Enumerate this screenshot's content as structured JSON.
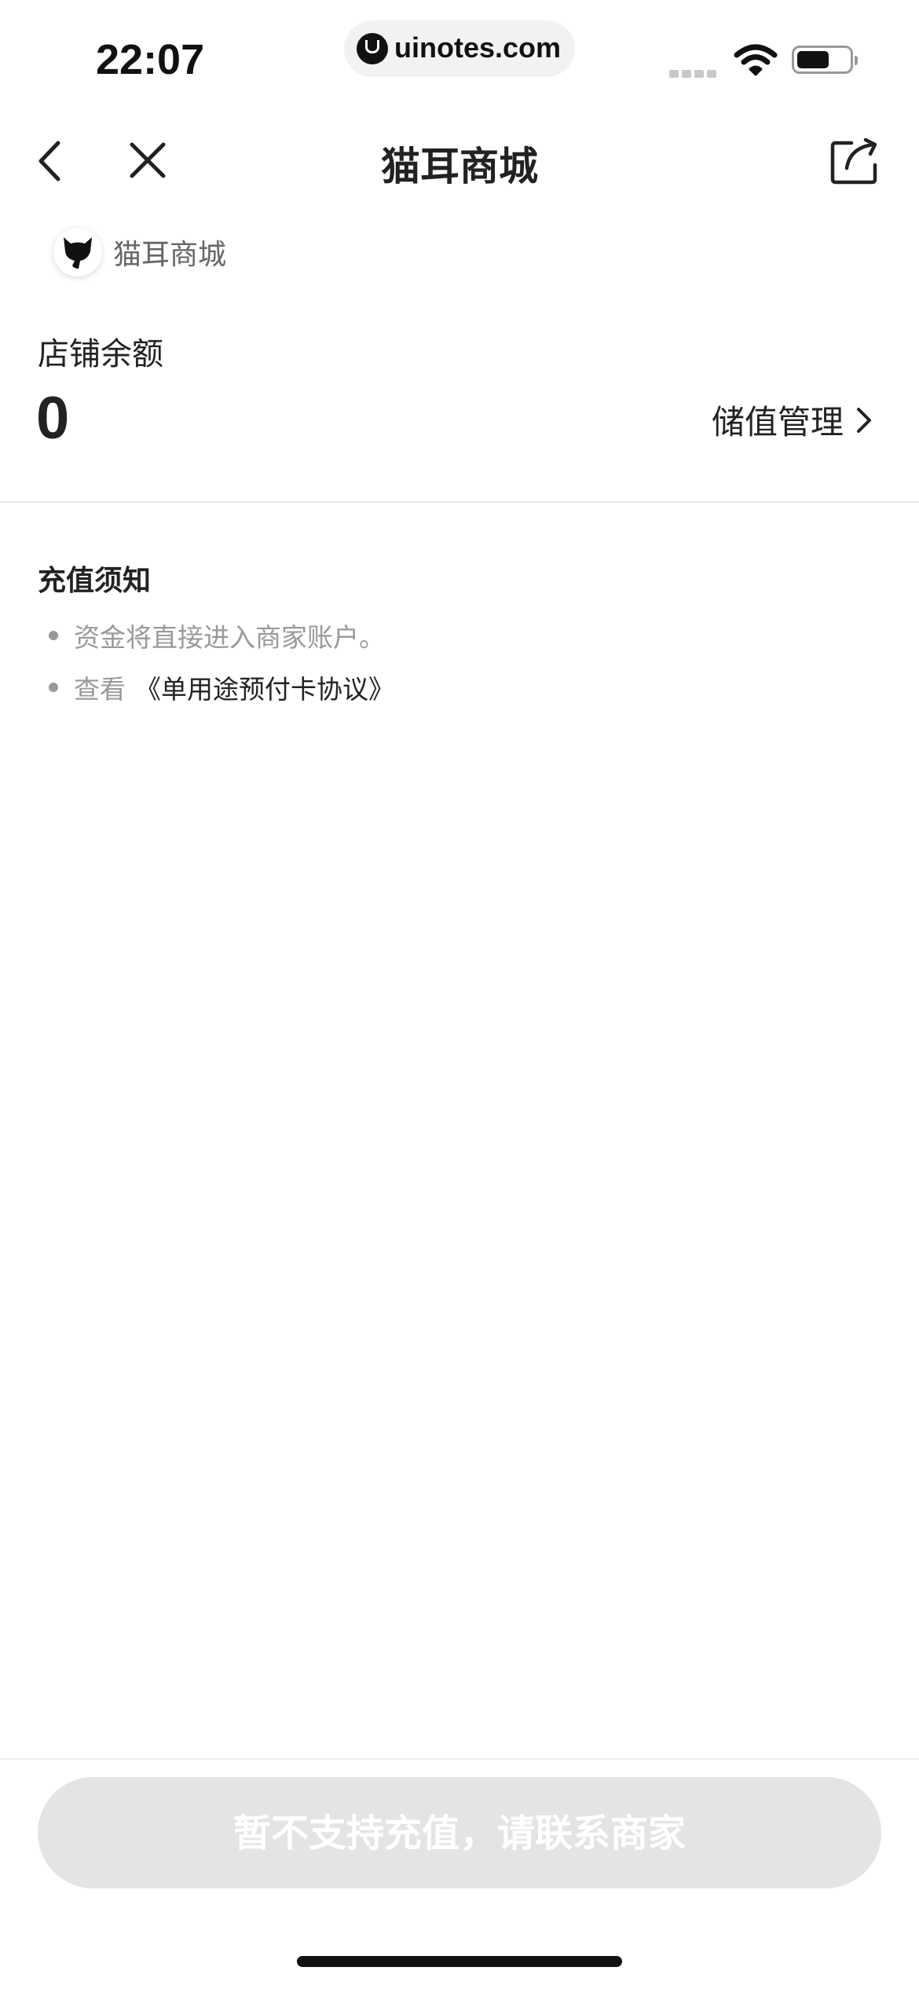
{
  "status_bar": {
    "time": "22:07",
    "url": "uinotes.com"
  },
  "nav": {
    "title": "猫耳商城"
  },
  "shop": {
    "name": "猫耳商城"
  },
  "balance": {
    "label": "店铺余额",
    "value": "0",
    "manage_label": "储值管理"
  },
  "notice": {
    "title": "充值须知",
    "item1": "资金将直接进入商家账户。",
    "item2_prefix": "查看",
    "item2_link": "《单用途预付卡协议》"
  },
  "bottom": {
    "button_label": "暂不支持充值，请联系商家"
  },
  "colors": {
    "text_primary": "#222222",
    "text_secondary": "#999999",
    "button_disabled_bg": "#e4e4e4"
  }
}
